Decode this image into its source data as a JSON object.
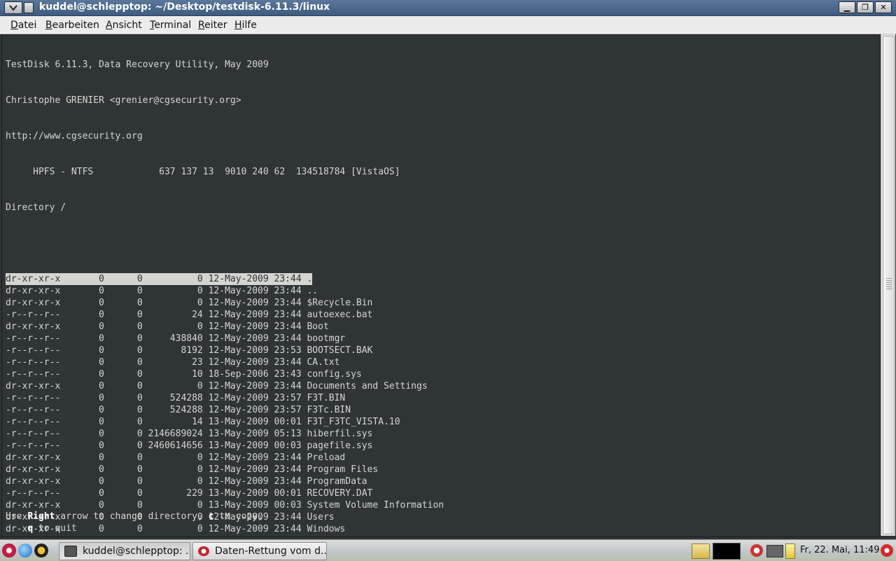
{
  "window": {
    "title": "kuddel@schlepptop: ~/Desktop/testdisk-6.11.3/linux",
    "buttons": {
      "minimize": "▁",
      "maximize": "❐",
      "close": "✕"
    }
  },
  "menubar": [
    {
      "label": "Datei"
    },
    {
      "label": "Bearbeiten"
    },
    {
      "label": "Ansicht"
    },
    {
      "label": "Terminal"
    },
    {
      "label": "Reiter"
    },
    {
      "label": "Hilfe"
    }
  ],
  "terminal": {
    "header": [
      "TestDisk 6.11.3, Data Recovery Utility, May 2009",
      "Christophe GRENIER <grenier@cgsecurity.org>",
      "http://www.cgsecurity.org",
      "     HPFS - NTFS            637 137 13  9010 240 62  134518784 [VistaOS]",
      "Directory /"
    ],
    "entries": [
      {
        "perm": "dr-xr-xr-x",
        "uid": "0",
        "gid": "0",
        "size": "0",
        "date": "12-May-2009",
        "time": "23:44",
        "name": "."
      },
      {
        "perm": "dr-xr-xr-x",
        "uid": "0",
        "gid": "0",
        "size": "0",
        "date": "12-May-2009",
        "time": "23:44",
        "name": ".."
      },
      {
        "perm": "dr-xr-xr-x",
        "uid": "0",
        "gid": "0",
        "size": "0",
        "date": "12-May-2009",
        "time": "23:44",
        "name": "$Recycle.Bin"
      },
      {
        "perm": "-r--r--r--",
        "uid": "0",
        "gid": "0",
        "size": "24",
        "date": "12-May-2009",
        "time": "23:44",
        "name": "autoexec.bat"
      },
      {
        "perm": "dr-xr-xr-x",
        "uid": "0",
        "gid": "0",
        "size": "0",
        "date": "12-May-2009",
        "time": "23:44",
        "name": "Boot"
      },
      {
        "perm": "-r--r--r--",
        "uid": "0",
        "gid": "0",
        "size": "438840",
        "date": "12-May-2009",
        "time": "23:44",
        "name": "bootmgr"
      },
      {
        "perm": "-r--r--r--",
        "uid": "0",
        "gid": "0",
        "size": "8192",
        "date": "12-May-2009",
        "time": "23:53",
        "name": "BOOTSECT.BAK"
      },
      {
        "perm": "-r--r--r--",
        "uid": "0",
        "gid": "0",
        "size": "23",
        "date": "12-May-2009",
        "time": "23:44",
        "name": "CA.txt"
      },
      {
        "perm": "-r--r--r--",
        "uid": "0",
        "gid": "0",
        "size": "10",
        "date": "18-Sep-2006",
        "time": "23:43",
        "name": "config.sys"
      },
      {
        "perm": "dr-xr-xr-x",
        "uid": "0",
        "gid": "0",
        "size": "0",
        "date": "12-May-2009",
        "time": "23:44",
        "name": "Documents and Settings"
      },
      {
        "perm": "-r--r--r--",
        "uid": "0",
        "gid": "0",
        "size": "524288",
        "date": "12-May-2009",
        "time": "23:57",
        "name": "F3T.BIN"
      },
      {
        "perm": "-r--r--r--",
        "uid": "0",
        "gid": "0",
        "size": "524288",
        "date": "12-May-2009",
        "time": "23:57",
        "name": "F3Tc.BIN"
      },
      {
        "perm": "-r--r--r--",
        "uid": "0",
        "gid": "0",
        "size": "14",
        "date": "13-May-2009",
        "time": "00:01",
        "name": "F3T_F3TC_VISTA.10"
      },
      {
        "perm": "-r--r--r--",
        "uid": "0",
        "gid": "0",
        "size": "2146689024",
        "date": "13-May-2009",
        "time": "05:13",
        "name": "hiberfil.sys"
      },
      {
        "perm": "-r--r--r--",
        "uid": "0",
        "gid": "0",
        "size": "2460614656",
        "date": "13-May-2009",
        "time": "00:03",
        "name": "pagefile.sys"
      },
      {
        "perm": "dr-xr-xr-x",
        "uid": "0",
        "gid": "0",
        "size": "0",
        "date": "12-May-2009",
        "time": "23:44",
        "name": "Preload"
      },
      {
        "perm": "dr-xr-xr-x",
        "uid": "0",
        "gid": "0",
        "size": "0",
        "date": "12-May-2009",
        "time": "23:44",
        "name": "Program Files"
      },
      {
        "perm": "dr-xr-xr-x",
        "uid": "0",
        "gid": "0",
        "size": "0",
        "date": "12-May-2009",
        "time": "23:44",
        "name": "ProgramData"
      },
      {
        "perm": "-r--r--r--",
        "uid": "0",
        "gid": "0",
        "size": "229",
        "date": "13-May-2009",
        "time": "00:01",
        "name": "RECOVERY.DAT"
      },
      {
        "perm": "dr-xr-xr-x",
        "uid": "0",
        "gid": "0",
        "size": "0",
        "date": "13-May-2009",
        "time": "00:03",
        "name": "System Volume Information"
      },
      {
        "perm": "dr-xr-xr-x",
        "uid": "0",
        "gid": "0",
        "size": "0",
        "date": "12-May-2009",
        "time": "23:44",
        "name": "Users"
      },
      {
        "perm": "dr-xr-xr-x",
        "uid": "0",
        "gid": "0",
        "size": "0",
        "date": "12-May-2009",
        "time": "23:44",
        "name": "Windows"
      }
    ],
    "selected_index": 0,
    "footer": {
      "use": "Use ",
      "right": "Right",
      "mid": " arrow to change directory, ",
      "c": "c",
      "copy": " to copy,",
      "indent": "    ",
      "q": "q",
      "quit": " to quit"
    }
  },
  "taskbar": {
    "tasks": [
      {
        "label": "kuddel@schlepptop: ...",
        "icon": "terminal-icon"
      },
      {
        "label": "Daten-Rettung vom d...",
        "icon": "browser-icon"
      }
    ],
    "clock": "Fr, 22. Mai, 11:49"
  },
  "colors": {
    "terminal_bg": "#2f3436",
    "terminal_fg": "#d6d6d2",
    "selection_bg": "#d4d4d0",
    "titlebar": "#4a6890"
  }
}
